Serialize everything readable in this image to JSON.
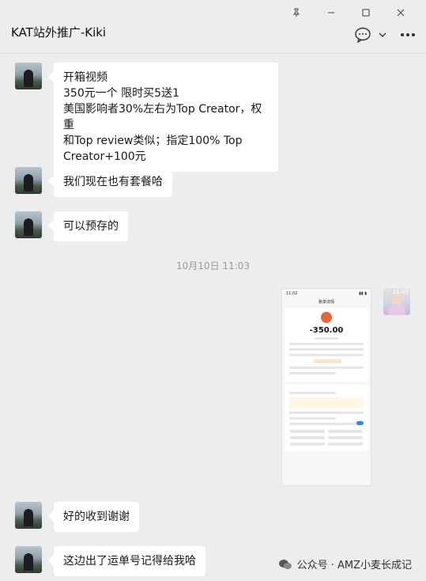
{
  "window": {
    "pin_icon": "pin-icon",
    "minimize_icon": "minimize-icon",
    "maximize_icon": "maximize-icon",
    "close_icon": "close-icon"
  },
  "chat": {
    "title": "KAT站外推广-Kiki"
  },
  "messages": [
    {
      "side": "left",
      "text": "开箱视频\n350元一个 限时买5送1\n美国影响者30%左右为Top Creator，权重\n和Top review类似；指定100% Top\nCreator+100元"
    },
    {
      "side": "left",
      "text": "我们现在也有套餐哈"
    },
    {
      "side": "left",
      "text": "可以预存的"
    },
    {
      "side": "center",
      "text": "10月10日 11:03"
    },
    {
      "side": "right",
      "type": "image",
      "amount": "-350.00"
    },
    {
      "side": "left",
      "text": "好的收到谢谢"
    },
    {
      "side": "left",
      "text": "这边出了运单号记得给我哈"
    }
  ],
  "avatar_right_time": "11:43",
  "watermark": {
    "text": "公众号 · AMZ小麦长成记"
  }
}
